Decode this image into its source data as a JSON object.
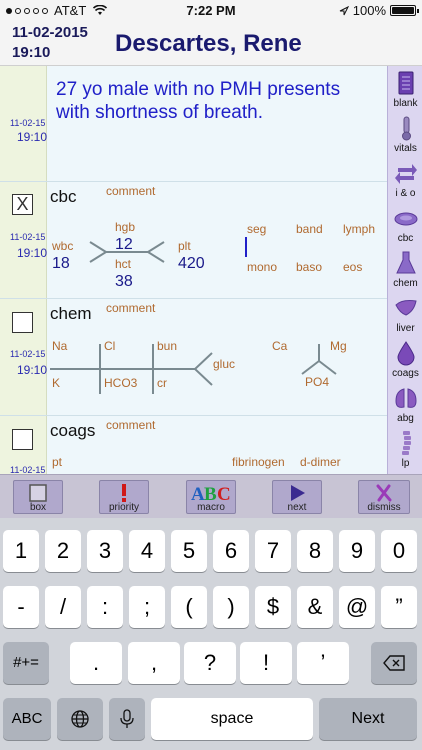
{
  "status_bar": {
    "carrier": "AT&T",
    "time": "7:22 PM",
    "battery": "100%",
    "battery_level": 1.0
  },
  "header": {
    "date": "11-02-2015",
    "time": "19:10",
    "patient_name": "Descartes, Rene"
  },
  "note": {
    "date": "11-02-15",
    "time": "19:10",
    "text": "27 yo male with no PMH presents with shortness of breath."
  },
  "cbc": {
    "title": "cbc",
    "checked": true,
    "check_mark": "X",
    "comment": "comment",
    "date": "11-02-15",
    "time": "19:10",
    "wbc_label": "wbc",
    "wbc": "18",
    "hgb_label": "hgb",
    "hgb": "12",
    "hct_label": "hct",
    "hct": "38",
    "plt_label": "plt",
    "plt": "420",
    "seg_label": "seg",
    "band_label": "band",
    "lymph_label": "lymph",
    "mono_label": "mono",
    "baso_label": "baso",
    "eos_label": "eos"
  },
  "chem": {
    "title": "chem",
    "checked": false,
    "comment": "comment",
    "date": "11-02-15",
    "time": "19:10",
    "na": "Na",
    "cl": "Cl",
    "bun": "bun",
    "k": "K",
    "hco3": "HCO3",
    "cr": "cr",
    "gluc": "gluc",
    "ca": "Ca",
    "mg": "Mg",
    "po4": "PO4"
  },
  "coags": {
    "title": "coags",
    "checked": false,
    "comment": "comment",
    "date": "11-02-15",
    "pt": "pt",
    "fibrinogen": "fibrinogen",
    "d_dimer": "d-dimer"
  },
  "sidebar": {
    "items": [
      {
        "label": "blank",
        "icon": "notepad-icon"
      },
      {
        "label": "vitals",
        "icon": "thermometer-icon"
      },
      {
        "label": "i & o",
        "icon": "arrows-icon"
      },
      {
        "label": "cbc",
        "icon": "blood-cell-icon"
      },
      {
        "label": "chem",
        "icon": "flask-icon"
      },
      {
        "label": "liver",
        "icon": "liver-icon"
      },
      {
        "label": "coags",
        "icon": "drop-icon"
      },
      {
        "label": "abg",
        "icon": "lungs-icon"
      },
      {
        "label": "lp",
        "icon": "spine-icon"
      }
    ]
  },
  "toolbar": {
    "box": "box",
    "priority": "priority",
    "macro": "macro",
    "next": "next",
    "dismiss": "dismiss"
  },
  "keyboard": {
    "row1": [
      "1",
      "2",
      "3",
      "4",
      "5",
      "6",
      "7",
      "8",
      "9",
      "0"
    ],
    "row2": [
      "-",
      "/",
      ":",
      ";",
      "(",
      ")",
      "$",
      "&",
      "@",
      "”"
    ],
    "row3": [
      ".",
      ",",
      "?",
      "!",
      "’"
    ],
    "shift_label": "#+=",
    "abc_label": "ABC",
    "space_label": "space",
    "return_label": "Next"
  }
}
